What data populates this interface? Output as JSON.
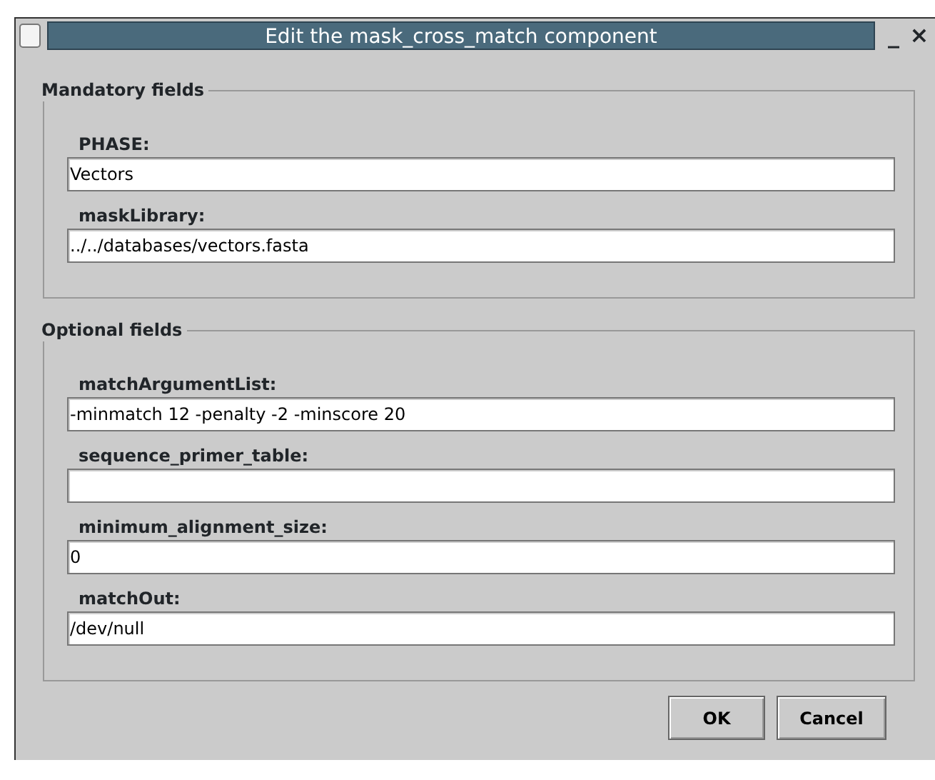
{
  "window": {
    "title": "Edit the mask_cross_match component",
    "controls": [
      "_",
      "×"
    ]
  },
  "groups": [
    {
      "title": "Mandatory fields",
      "fields": [
        {
          "label": "PHASE:",
          "value": "Vectors"
        },
        {
          "label": "maskLibrary:",
          "value": "../../databases/vectors.fasta"
        }
      ]
    },
    {
      "title": "Optional fields",
      "fields": [
        {
          "label": "matchArgumentList:",
          "value": "-minmatch 12 -penalty -2 -minscore 20"
        },
        {
          "label": "sequence_primer_table:"
        },
        {
          "label": "minimum_alignment_size:",
          "value": "0"
        },
        {
          "label": "matchOut:",
          "value": "/dev/null"
        }
      ]
    }
  ],
  "buttons": [
    {
      "label": "OK"
    },
    {
      "label": "Cancel"
    }
  ]
}
